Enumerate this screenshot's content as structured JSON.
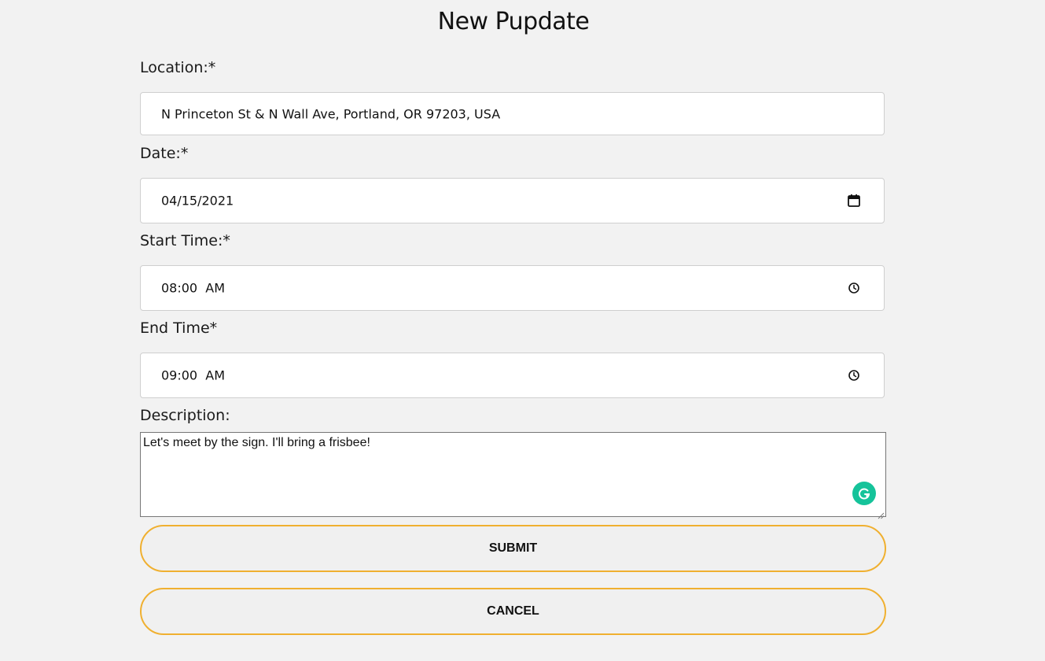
{
  "page": {
    "title": "New Pupdate"
  },
  "form": {
    "location": {
      "label": "Location:*",
      "value": "N Princeton St & N Wall Ave, Portland, OR 97203, USA"
    },
    "date": {
      "label": "Date:*",
      "value": "04/15/2021",
      "icon": "calendar-icon"
    },
    "start_time": {
      "label": "Start Time:*",
      "value": "08:00  AM",
      "icon": "clock-icon"
    },
    "end_time": {
      "label": "End Time*",
      "value": "09:00  AM",
      "icon": "clock-icon"
    },
    "description": {
      "label": "Description:",
      "value": "Let's meet by the sign. I'll bring a frisbee!",
      "extension_icon": "grammarly-icon"
    }
  },
  "buttons": {
    "submit": "SUBMIT",
    "cancel": "CANCEL"
  },
  "colors": {
    "background": "#f2f2f2",
    "button_border": "#f0b030",
    "grammarly": "#15c39a"
  }
}
